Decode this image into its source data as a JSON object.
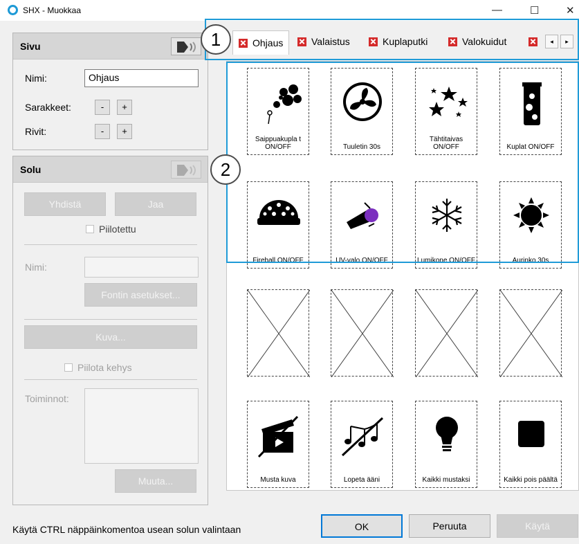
{
  "window": {
    "title": "SHX - Muokkaa",
    "minimize": "—",
    "maximize": "☐",
    "close": "✕"
  },
  "sivu": {
    "header": "Sivu",
    "name_label": "Nimi:",
    "name_value": "Ohjaus",
    "columns_label": "Sarakkeet:",
    "rows_label": "Rivit:",
    "minus": "-",
    "plus": "+"
  },
  "solu": {
    "header": "Solu",
    "merge_label": "Yhdistä",
    "split_label": "Jaa",
    "hidden_label": "Piilotettu",
    "name_label": "Nimi:",
    "font_button": "Fontin asetukset...",
    "image_button": "Kuva...",
    "hide_frame_label": "Piilota kehys",
    "actions_label": "Toiminnot:",
    "change_button": "Muuta..."
  },
  "tabs": [
    {
      "label": "Ohjaus",
      "active": true
    },
    {
      "label": "Valaistus",
      "active": false
    },
    {
      "label": "Kuplaputki",
      "active": false
    },
    {
      "label": "Valokuidut",
      "active": false
    }
  ],
  "tab_scroll": {
    "left": "◂",
    "right": "▸"
  },
  "cells": [
    {
      "label": "Saippuakupla t ON/OFF",
      "icon": "bubbles-icon"
    },
    {
      "label": "Tuuletin 30s",
      "icon": "fan-icon"
    },
    {
      "label": "Tähtitaivas ON/OFF",
      "icon": "stars-icon"
    },
    {
      "label": "Kuplat ON/OFF",
      "icon": "bubble-tube-icon"
    },
    {
      "label": "Fireball ON/OFF",
      "icon": "fireball-icon"
    },
    {
      "label": "UV-valo ON/OFF",
      "icon": "uv-light-icon"
    },
    {
      "label": "Lumikone ON/OFF",
      "icon": "snowflake-icon"
    },
    {
      "label": "Aurinko 30s",
      "icon": "sun-icon"
    },
    {
      "label": "Musta kuva",
      "icon": "clapperboard-off-icon"
    },
    {
      "label": "Lopeta ääni",
      "icon": "music-off-icon"
    },
    {
      "label": "Kaikki mustaksi",
      "icon": "bulb-icon"
    },
    {
      "label": "Kaikki pois päältä",
      "icon": "stop-square-icon"
    }
  ],
  "annotations": {
    "one": "1",
    "two": "2"
  },
  "footer": {
    "status": "Käytä CTRL näppäinkomentoa usean solun valintaan",
    "ok": "OK",
    "cancel": "Peruuta",
    "apply": "Käytä"
  },
  "colors": {
    "highlight": "#1f9bd7",
    "tab_close": "#d42a2a"
  }
}
